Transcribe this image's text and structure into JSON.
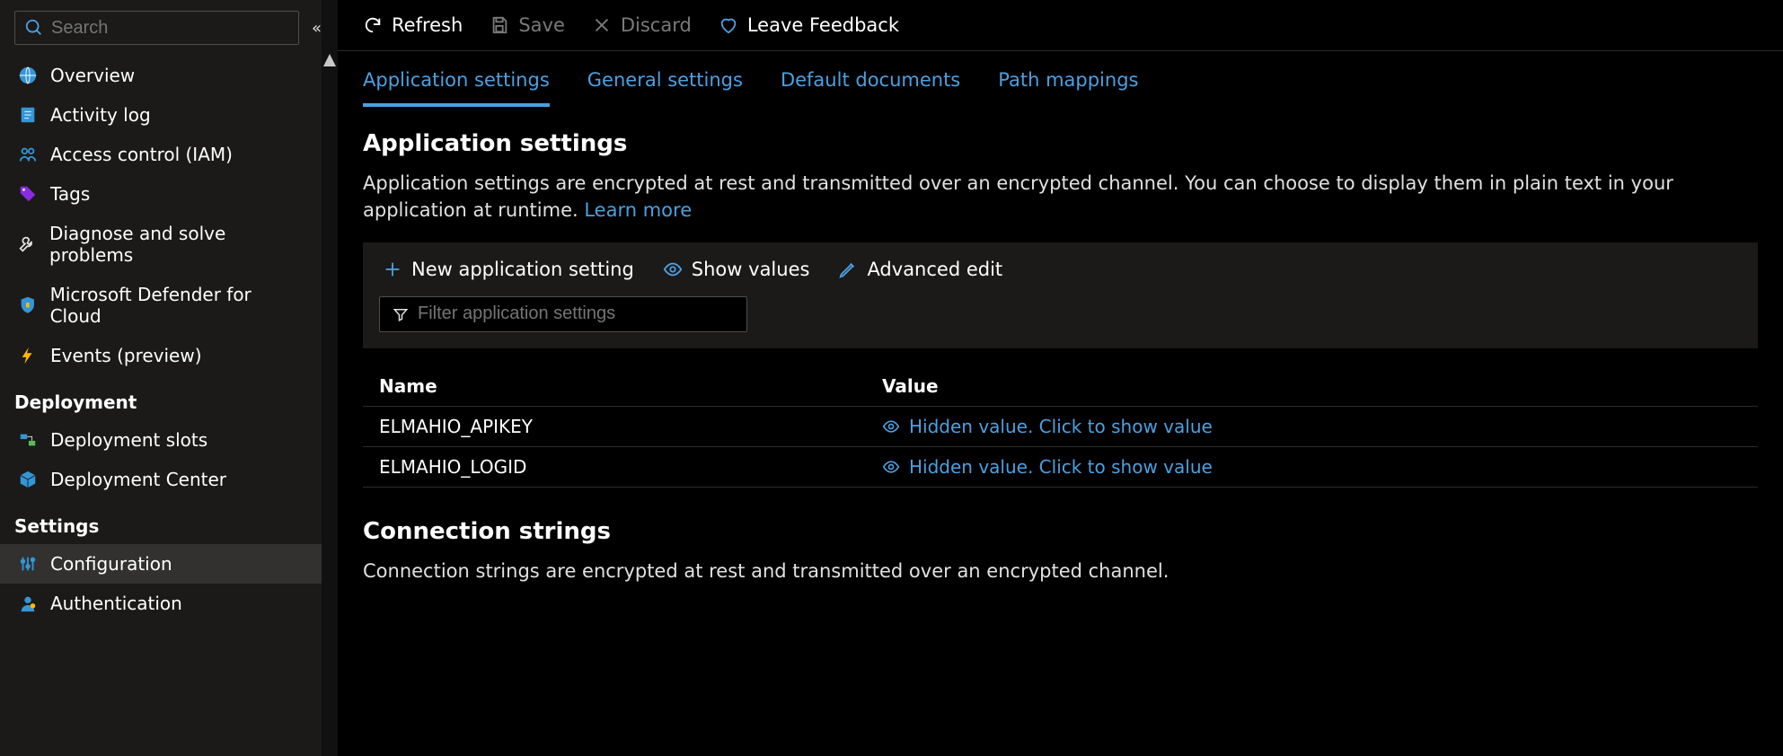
{
  "sidebar": {
    "search_placeholder": "Search",
    "collapse_icon": "«",
    "nav_items": [
      {
        "label": "Overview",
        "icon": "globe"
      },
      {
        "label": "Activity log",
        "icon": "log"
      },
      {
        "label": "Access control (IAM)",
        "icon": "iam"
      },
      {
        "label": "Tags",
        "icon": "tag"
      },
      {
        "label": "Diagnose and solve problems",
        "icon": "wrench"
      },
      {
        "label": "Microsoft Defender for Cloud",
        "icon": "shield"
      },
      {
        "label": "Events (preview)",
        "icon": "bolt"
      }
    ],
    "section_deployment": "Deployment",
    "deployment_items": [
      {
        "label": "Deployment slots",
        "icon": "slots"
      },
      {
        "label": "Deployment Center",
        "icon": "cube"
      }
    ],
    "section_settings": "Settings",
    "settings_items": [
      {
        "label": "Configuration",
        "icon": "sliders",
        "active": true
      },
      {
        "label": "Authentication",
        "icon": "person"
      }
    ]
  },
  "toolbar": {
    "refresh": "Refresh",
    "save": "Save",
    "discard": "Discard",
    "feedback": "Leave Feedback"
  },
  "tabs": [
    {
      "label": "Application settings",
      "active": true
    },
    {
      "label": "General settings"
    },
    {
      "label": "Default documents"
    },
    {
      "label": "Path mappings"
    }
  ],
  "appsettings": {
    "title": "Application settings",
    "desc_pre": "Application settings are encrypted at rest and transmitted over an encrypted channel. You can choose to display them in plain text in your application at runtime. ",
    "learn_more": "Learn more",
    "cmd_new": "New application setting",
    "cmd_show": "Show values",
    "cmd_adv": "Advanced edit",
    "filter_placeholder": "Filter application settings",
    "col_name": "Name",
    "col_value": "Value",
    "rows": [
      {
        "name": "ELMAHIO_APIKEY",
        "value_text": "Hidden value. Click to show value"
      },
      {
        "name": "ELMAHIO_LOGID",
        "value_text": "Hidden value. Click to show value"
      }
    ]
  },
  "connstrings": {
    "title": "Connection strings",
    "desc": "Connection strings are encrypted at rest and transmitted over an encrypted channel."
  }
}
